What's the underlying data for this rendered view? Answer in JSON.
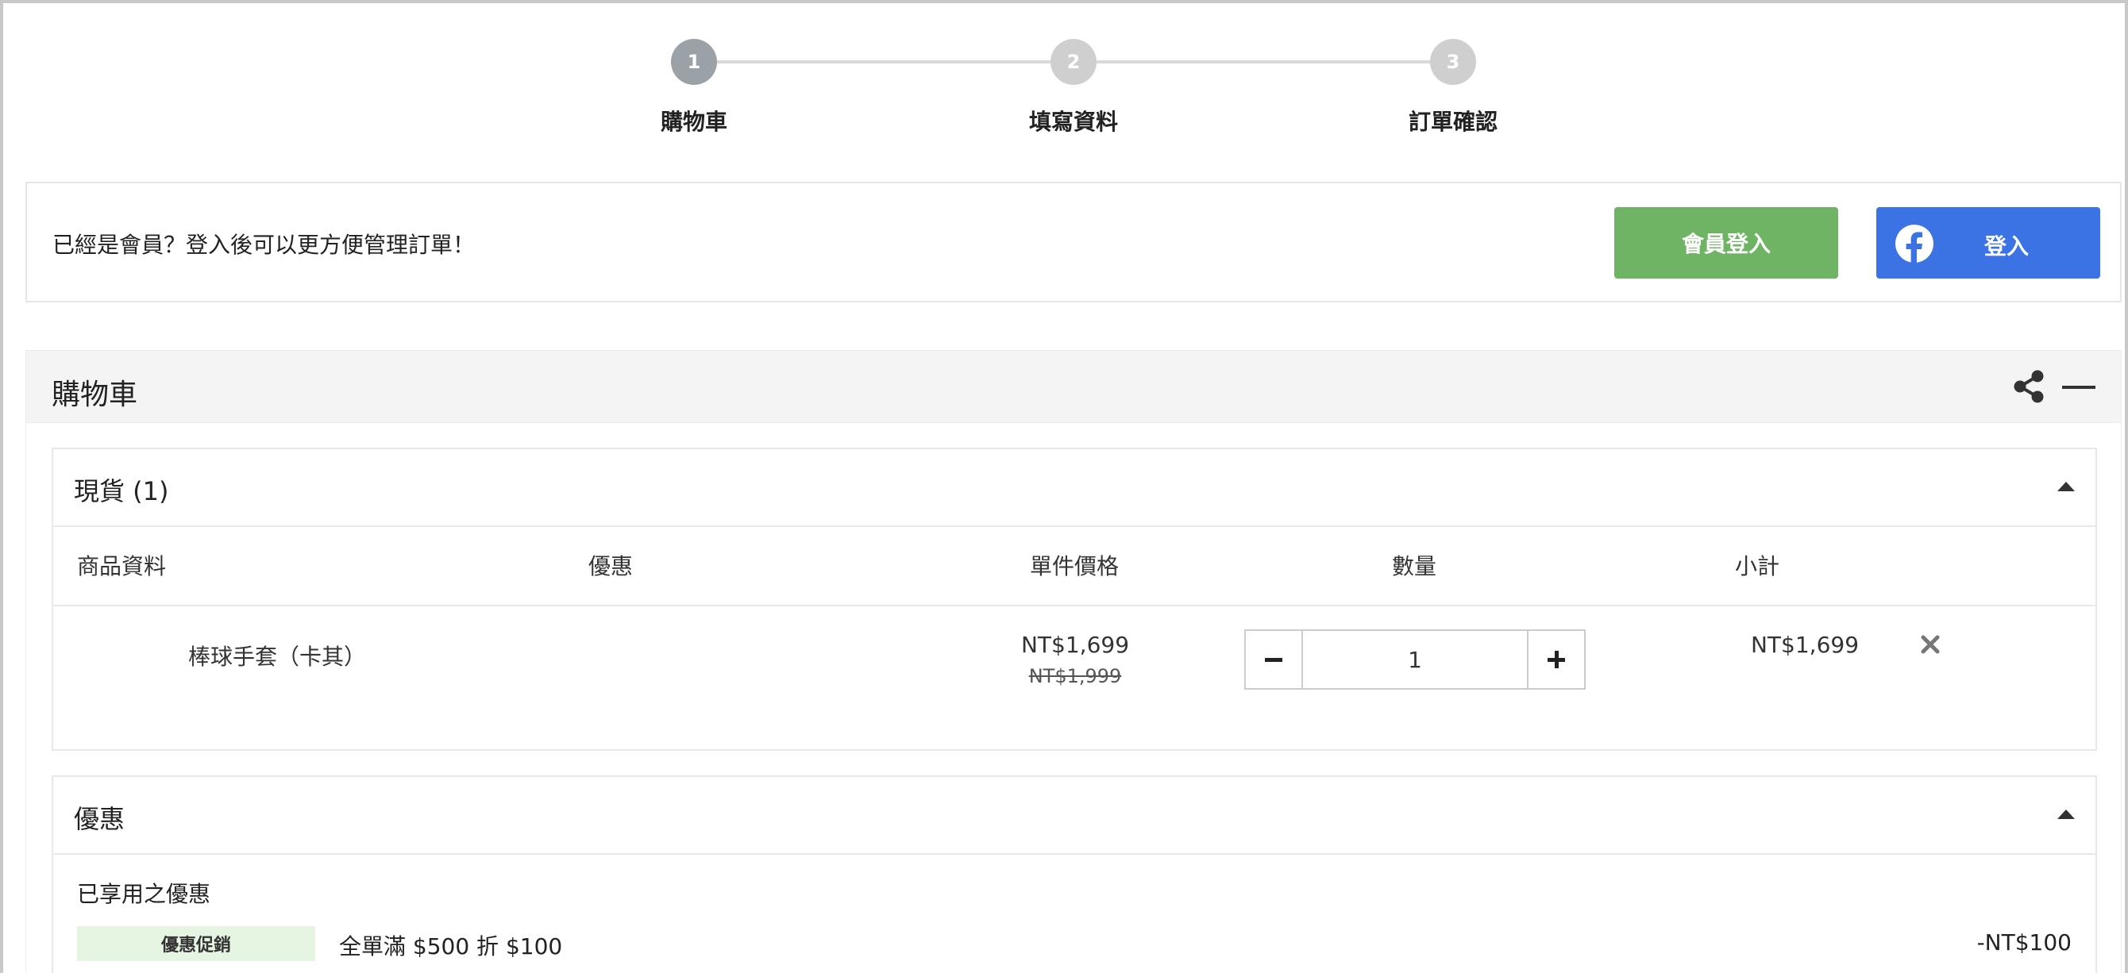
{
  "steps": [
    {
      "number": "1",
      "label": "購物車",
      "active": true
    },
    {
      "number": "2",
      "label": "填寫資料",
      "active": false
    },
    {
      "number": "3",
      "label": "訂單確認",
      "active": false
    }
  ],
  "login": {
    "message": "已經是會員？登入後可以更方便管理訂單！",
    "member_button": "會員登入",
    "facebook_button": "登入",
    "facebook_color": "#3b73e5",
    "member_color": "#6fb464"
  },
  "cart": {
    "title": "購物車",
    "share_icon": "share-icon",
    "collapse_icon": "minus-icon",
    "stock_section": {
      "title": "現貨 (1)",
      "columns": {
        "product": "商品資料",
        "discount": "優惠",
        "unit_price": "單件價格",
        "quantity": "數量",
        "subtotal": "小計"
      },
      "items": [
        {
          "name": "棒球手套（卡其）",
          "price": "NT$1,699",
          "original_price": "NT$1,999",
          "quantity": "1",
          "subtotal": "NT$1,699"
        }
      ]
    },
    "discount_section": {
      "title": "優惠",
      "applied_label": "已享用之優惠",
      "promotions": [
        {
          "tag": "優惠促銷",
          "description": "全單滿 $500 折 $100",
          "amount": "-NT$100"
        }
      ]
    }
  }
}
